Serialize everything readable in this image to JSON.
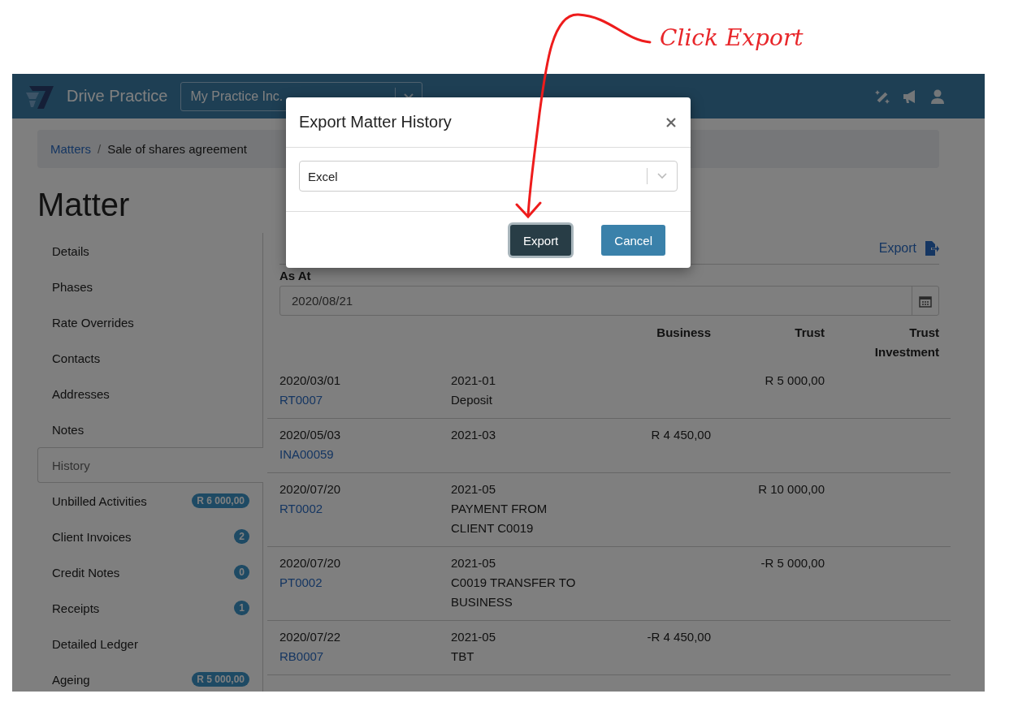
{
  "annotation": {
    "text": "Click Export"
  },
  "navbar": {
    "brand": "Drive Practice",
    "practice_select": {
      "value": "My Practice Inc."
    }
  },
  "breadcrumb": {
    "separator": "/",
    "items": [
      {
        "label": "Matters",
        "kind": "link"
      },
      {
        "label": "Sale of shares agreement",
        "kind": "current"
      }
    ]
  },
  "page_title": "Matter",
  "sidebar": {
    "items": [
      {
        "label": "Details",
        "selected": false
      },
      {
        "label": "Phases",
        "selected": false
      },
      {
        "label": "Rate Overrides",
        "selected": false
      },
      {
        "label": "Contacts",
        "selected": false
      },
      {
        "label": "Addresses",
        "selected": false
      },
      {
        "label": "Notes",
        "selected": false
      },
      {
        "label": "History",
        "selected": true
      },
      {
        "label": "Unbilled Activities",
        "selected": false,
        "badge": "R 6 000,00"
      },
      {
        "label": "Client Invoices",
        "selected": false,
        "badge": "2"
      },
      {
        "label": "Credit Notes",
        "selected": false,
        "badge": "0"
      },
      {
        "label": "Receipts",
        "selected": false,
        "badge": "1"
      },
      {
        "label": "Detailed Ledger",
        "selected": false
      },
      {
        "label": "Ageing",
        "selected": false,
        "badge": "R 5 000,00"
      }
    ]
  },
  "history": {
    "export_link": "Export",
    "as_at": {
      "label": "As At",
      "value": "2020/08/21"
    },
    "columns": [
      "Business",
      "Trust",
      "Trust Investment"
    ],
    "rows": [
      {
        "date": "2020/03/01",
        "ref": "RT0007",
        "period": "2021-01",
        "description": "Deposit",
        "trust": "R 5 000,00"
      },
      {
        "date": "2020/05/03",
        "ref": "INA00059",
        "period": "2021-03",
        "business": "R 4 450,00"
      },
      {
        "date": "2020/07/20",
        "ref": "RT0002",
        "period": "2021-05",
        "description": "PAYMENT FROM CLIENT C0019",
        "trust": "R 10 000,00"
      },
      {
        "date": "2020/07/20",
        "ref": "PT0002",
        "period": "2021-05",
        "description": "C0019 TRANSFER TO BUSINESS",
        "trust": "-R 5 000,00"
      },
      {
        "date": "2020/07/22",
        "ref": "RB0007",
        "period": "2021-05",
        "description": "TBT",
        "business": "-R 4 450,00"
      }
    ]
  },
  "dialog": {
    "title": "Export Matter History",
    "format_select": {
      "value": "Excel"
    },
    "buttons": [
      {
        "label": "Export",
        "kind": "primary",
        "focused": true
      },
      {
        "label": "Cancel",
        "kind": "secondary",
        "focused": false
      }
    ]
  }
}
